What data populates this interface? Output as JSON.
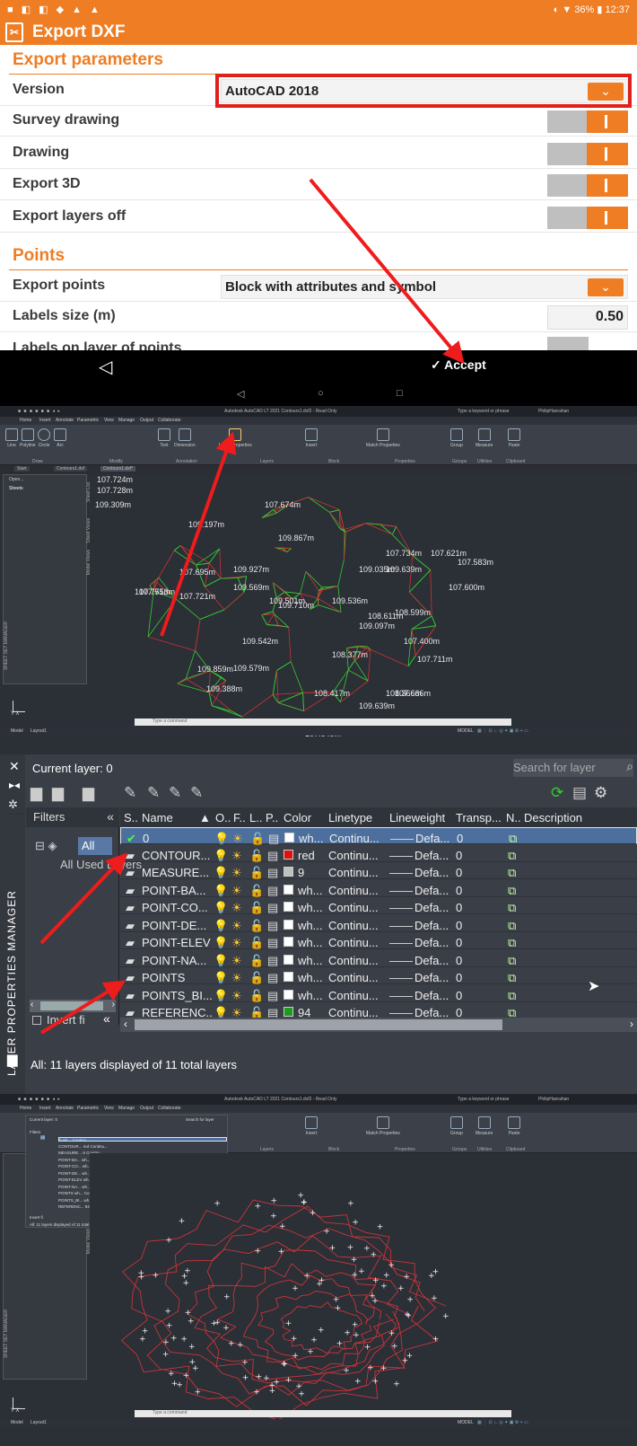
{
  "status": {
    "left_icons": "■ ◧ ◧ ◆ ▲ ▲",
    "right": "◐ ▼ 36% ▮ 12:37"
  },
  "app": {
    "title": "Export DXF",
    "logo": "✂"
  },
  "form": {
    "section1": "Export parameters",
    "version_label": "Version",
    "version_value": "AutoCAD 2018",
    "survey_label": "Survey drawing",
    "drawing_label": "Drawing",
    "export3d_label": "Export 3D",
    "layers_off_label": "Export layers off",
    "section2": "Points",
    "export_points_label": "Export points",
    "export_points_value": "Block with attributes and symbol",
    "labels_size_label": "Labels size (m)",
    "labels_size_value": "0.50",
    "partial_label": "Labels on layer of points",
    "dropdown_icon": "chevron-down"
  },
  "bottom": {
    "back": "◁",
    "accept": "✓ Accept"
  },
  "navbar": {
    "back": "◁",
    "home": "○",
    "recent": "□"
  },
  "cad1": {
    "title": "Autodesk AutoCAD LT 2021   Contours1.dxf2 - Read Only",
    "search_hint": "Type a keyword or phrase",
    "user": "PhilipHanrahan",
    "menus": [
      "Home",
      "Insert",
      "Annotate",
      "Parametric",
      "View",
      "Manage",
      "Output",
      "Collaborate"
    ],
    "tools": [
      "Line",
      "Polyline",
      "Circle",
      "Arc",
      "Text",
      "Dimension",
      "Layer Properties",
      "Insert",
      "Match Properties",
      "Group",
      "Measure",
      "Paste"
    ],
    "groups": [
      "Draw",
      "Modify",
      "Annotation",
      "Layers",
      "Block",
      "Properties",
      "Groups",
      "Utilities",
      "Clipboard"
    ],
    "tabs": [
      "Start",
      "Contours1.dxf",
      "Contours1.dxf*"
    ],
    "panel": "Sheets",
    "panel_open": "Open...",
    "side_labels": [
      "SHEET SET MANAGER",
      "Sheet List",
      "Sheet Views",
      "Model Views"
    ],
    "cmd_hint": "Type a command",
    "status_tabs": [
      "Model",
      "Layout1"
    ],
    "status_right": "MODEL",
    "ucs": "Y X"
  },
  "cad_points": [
    {
      "t": "107.724m"
    },
    {
      "t": "107.728m"
    },
    {
      "t": "109.309m"
    },
    {
      "t": "107.674m"
    },
    {
      "t": "109.197m"
    },
    {
      "t": "109.867m"
    },
    {
      "t": "107.734m"
    },
    {
      "t": "107.621m"
    },
    {
      "t": "107.583m"
    },
    {
      "t": "109.035m"
    },
    {
      "t": "109.639m"
    },
    {
      "t": "107.600m"
    },
    {
      "t": "109.569m"
    },
    {
      "t": "109.501m"
    },
    {
      "t": "109.710m"
    },
    {
      "t": "109.536m"
    },
    {
      "t": "108.611m"
    },
    {
      "t": "108.599m"
    },
    {
      "t": "107.753m"
    },
    {
      "t": "107.721m"
    },
    {
      "t": "109.542m"
    },
    {
      "t": "108.377m"
    },
    {
      "t": "107.711m"
    },
    {
      "t": "109.579m"
    },
    {
      "t": "109.388m"
    },
    {
      "t": "108.417m"
    },
    {
      "t": "107.666m"
    },
    {
      "t": "107.649m"
    },
    {
      "t": "109.927m"
    },
    {
      "t": "107.695m"
    },
    {
      "t": "107.751m"
    },
    {
      "t": "109.097m"
    },
    {
      "t": "109.859m"
    },
    {
      "t": "109.639m"
    },
    {
      "t": "108.366m"
    },
    {
      "t": "107.400m"
    }
  ],
  "lpm": {
    "current": "Current layer: 0",
    "search": "Search for layer",
    "filters": "Filters",
    "all": "All",
    "all_used": "All Used Layers",
    "invert": "Invert fi",
    "footer": "All: 11 layers displayed of 11 total layers",
    "side_title": "LAYER PROPERTIES MANAGER",
    "headers": [
      "S..",
      "Name",
      "O..",
      "F..",
      "L..",
      "P..",
      "Color",
      "Linetype",
      "Lineweight",
      "Transp...",
      "N..",
      "Description"
    ],
    "rows": [
      {
        "status": "✔",
        "name": "0",
        "color": "wh...",
        "swatch": "#ffffff",
        "lt": "Continu...",
        "lw": "Defa...",
        "tr": "0",
        "selected": true
      },
      {
        "status": "▰",
        "name": "CONTOUR...",
        "color": "red",
        "swatch": "#e01010",
        "lt": "Continu...",
        "lw": "Defa...",
        "tr": "0",
        "selected": false
      },
      {
        "status": "▰",
        "name": "MEASURE...",
        "color": "9",
        "swatch": "#c0c0c0",
        "lt": "Continu...",
        "lw": "Defa...",
        "tr": "0",
        "selected": false
      },
      {
        "status": "▰",
        "name": "POINT-BA...",
        "color": "wh...",
        "swatch": "#ffffff",
        "lt": "Continu...",
        "lw": "Defa...",
        "tr": "0",
        "selected": false
      },
      {
        "status": "▰",
        "name": "POINT-CO...",
        "color": "wh...",
        "swatch": "#ffffff",
        "lt": "Continu...",
        "lw": "Defa...",
        "tr": "0",
        "selected": false
      },
      {
        "status": "▰",
        "name": "POINT-DE...",
        "color": "wh...",
        "swatch": "#ffffff",
        "lt": "Continu...",
        "lw": "Defa...",
        "tr": "0",
        "selected": false
      },
      {
        "status": "▰",
        "name": "POINT-ELEV",
        "color": "wh...",
        "swatch": "#ffffff",
        "lt": "Continu...",
        "lw": "Defa...",
        "tr": "0",
        "selected": false
      },
      {
        "status": "▰",
        "name": "POINT-NA...",
        "color": "wh...",
        "swatch": "#ffffff",
        "lt": "Continu...",
        "lw": "Defa...",
        "tr": "0",
        "selected": false
      },
      {
        "status": "▰",
        "name": "POINTS",
        "color": "wh...",
        "swatch": "#ffffff",
        "lt": "Continu...",
        "lw": "Defa...",
        "tr": "0",
        "selected": false
      },
      {
        "status": "▰",
        "name": "POINTS_BI...",
        "color": "wh...",
        "swatch": "#ffffff",
        "lt": "Continu...",
        "lw": "Defa...",
        "tr": "0",
        "selected": false
      },
      {
        "status": "▰",
        "name": "REFERENC...",
        "color": "94",
        "swatch": "#1f9a1f",
        "lt": "Continu...",
        "lw": "Defa...",
        "tr": "0",
        "selected": false
      }
    ]
  },
  "colors": {
    "accent": "#ee7d24",
    "highlight": "#e0201b",
    "row_selected": "#4d6f9d"
  }
}
